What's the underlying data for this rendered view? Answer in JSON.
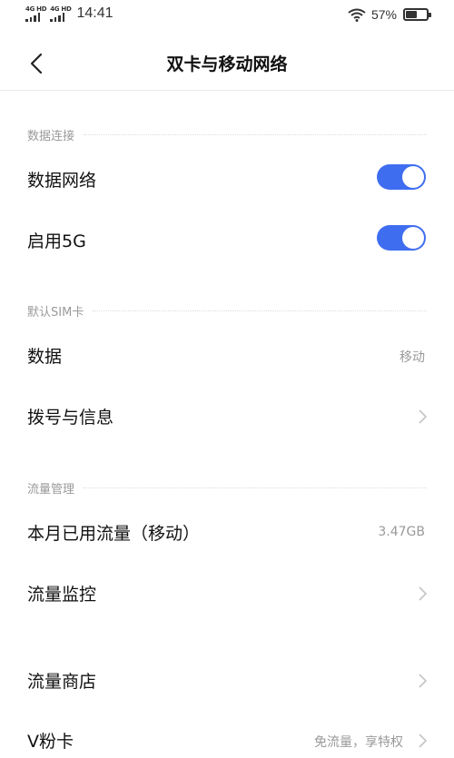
{
  "status_bar": {
    "signal1_label": "4G HD",
    "signal2_label": "4G HD",
    "time": "14:41",
    "battery_pct": "57%",
    "battery_level": 0.57
  },
  "header": {
    "title": "双卡与移动网络",
    "back_icon": "chevron-left-icon"
  },
  "sections": {
    "data_connection": "数据连接",
    "default_sim": "默认SIM卡",
    "traffic_mgmt": "流量管理"
  },
  "rows": {
    "data_network": {
      "label": "数据网络",
      "on": true
    },
    "enable_5g": {
      "label": "启用5G",
      "on": true
    },
    "data": {
      "label": "数据",
      "value": "移动"
    },
    "dial_sms": {
      "label": "拨号与信息"
    },
    "monthly_usage": {
      "label": "本月已用流量（移动）",
      "value": "3.47GB"
    },
    "traffic_monitor": {
      "label": "流量监控"
    },
    "traffic_store": {
      "label": "流量商店"
    },
    "v_card": {
      "label": "V粉卡",
      "value": "免流量，享特权"
    }
  },
  "colors": {
    "accent": "#3f6df0",
    "secondary_text": "#999999"
  }
}
